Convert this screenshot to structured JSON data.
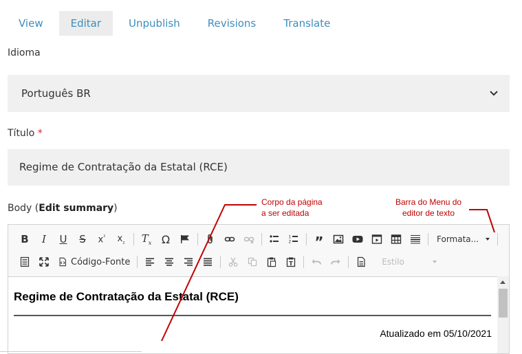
{
  "tabs": [
    {
      "label": "View"
    },
    {
      "label": "Editar"
    },
    {
      "label": "Unpublish"
    },
    {
      "label": "Revisions"
    },
    {
      "label": "Translate"
    }
  ],
  "active_tab": "Editar",
  "language": {
    "label": "Idioma",
    "value": "Português BR"
  },
  "title_field": {
    "label": "Título",
    "required_mark": "*",
    "value": "Regime de Contratação da Estatal (RCE)"
  },
  "body": {
    "label_prefix": "Body (",
    "summary_link": "Edit summary",
    "label_suffix": ")"
  },
  "toolbar": {
    "source_label": "Código-Fonte",
    "format_combo": "Formata...",
    "style_combo": "Estilo"
  },
  "content": {
    "heading": "Regime de Contratação da Estatal (RCE)",
    "updated": "Atualizado em 05/10/2021"
  },
  "annotations": {
    "body_note_line1": "Corpo da página",
    "body_note_line2": "a ser editada",
    "menu_note_line1": "Barra do Menu do",
    "menu_note_line2": "editor de texto"
  },
  "colors": {
    "link": "#3b8dbd",
    "annotation": "#c00000",
    "required": "#dd2222"
  }
}
